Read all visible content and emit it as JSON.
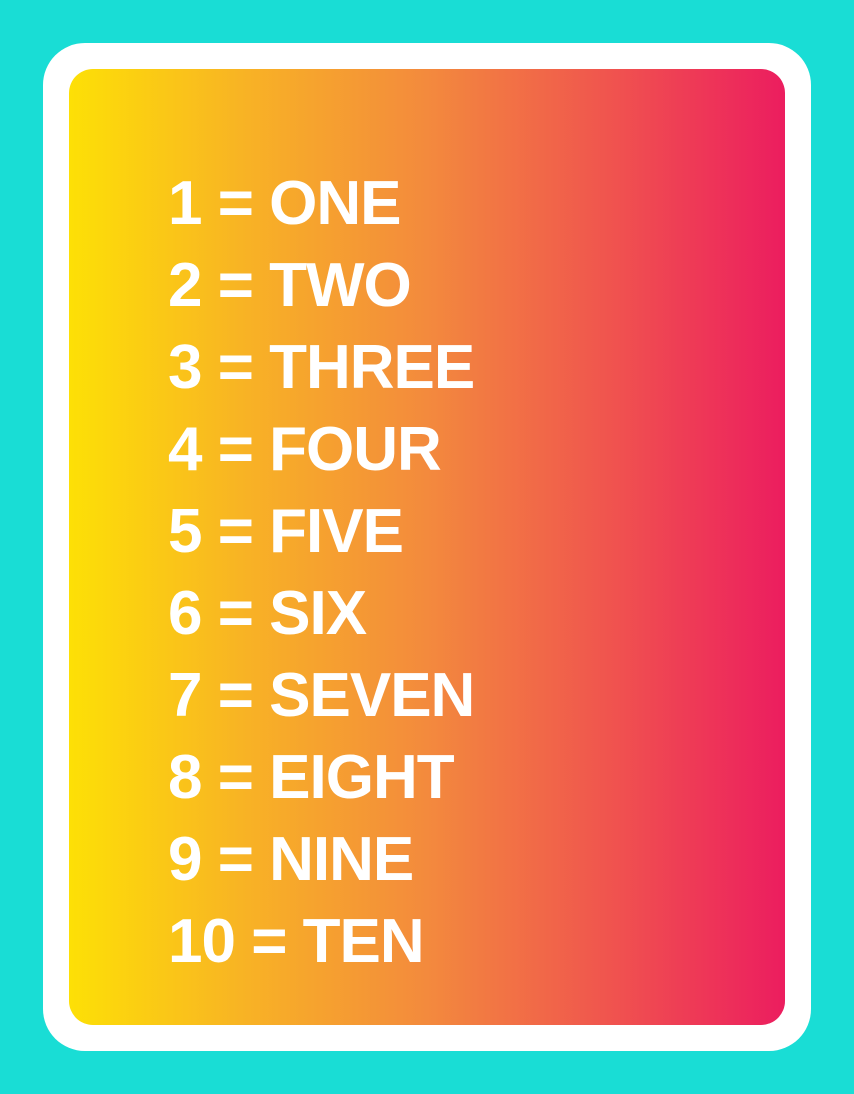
{
  "colors": {
    "background": "#19DDD5",
    "frame": "#FFFFFF",
    "gradient_start": "#FDE006",
    "gradient_end": "#EC1D5F",
    "text": "#FFFFFF"
  },
  "numbers": [
    {
      "text": "1 = ONE"
    },
    {
      "text": "2 = TWO"
    },
    {
      "text": "3 = THREE"
    },
    {
      "text": "4 = FOUR"
    },
    {
      "text": "5 = FIVE"
    },
    {
      "text": "6 = SIX"
    },
    {
      "text": "7 = SEVEN"
    },
    {
      "text": "8 = EIGHT"
    },
    {
      "text": "9 = NINE"
    },
    {
      "text": "10 = TEN"
    }
  ]
}
